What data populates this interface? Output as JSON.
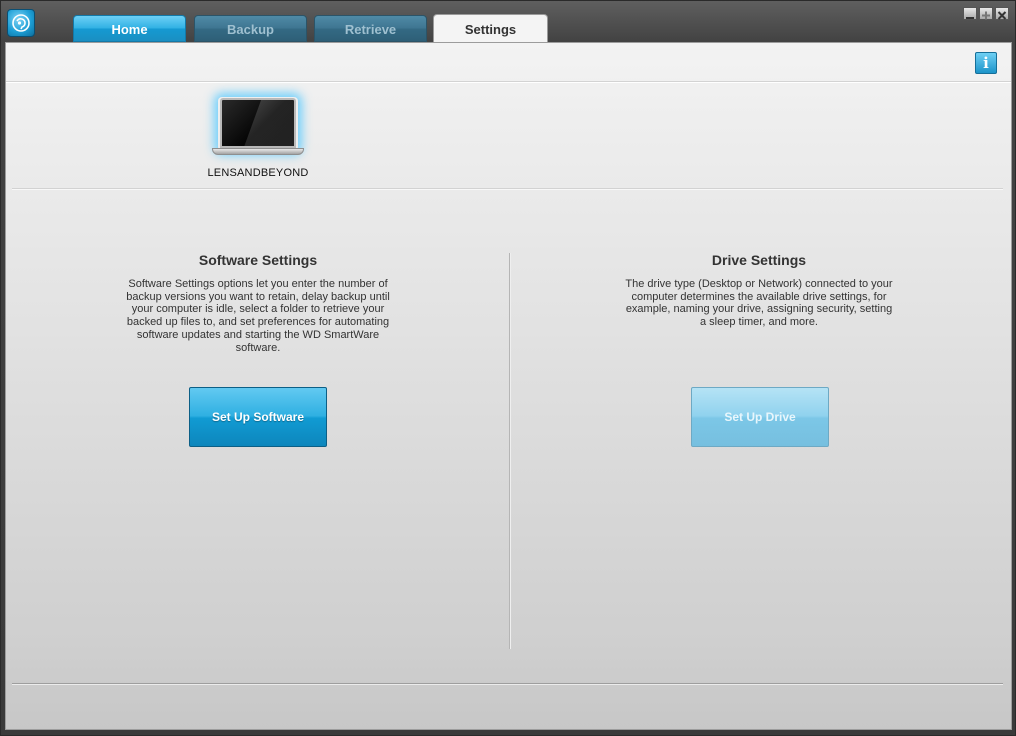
{
  "window": {
    "app_icon": "wd-smartware-app-icon",
    "controls": {
      "minimize_icon": "minimize-icon",
      "maximize_icon": "maximize-icon",
      "close_icon": "close-icon"
    }
  },
  "tabs": [
    {
      "label": "Home",
      "state": "enabled"
    },
    {
      "label": "Backup",
      "state": "disabled"
    },
    {
      "label": "Retrieve",
      "state": "disabled"
    },
    {
      "label": "Settings",
      "state": "active"
    }
  ],
  "toolbar": {
    "info_icon": "info-icon",
    "info_glyph": "i"
  },
  "device": {
    "icon": "laptop-icon",
    "name": "LENSANDBEYOND"
  },
  "software_settings": {
    "title": "Software Settings",
    "description": "Software Settings options let you enter the number of backup versions you want to retain, delay backup until your computer is idle, select a folder to retrieve your backed up files to, and set preferences for automating software updates and starting the WD SmartWare software.",
    "button_label": "Set Up Software",
    "button_state": "enabled"
  },
  "drive_settings": {
    "title": "Drive Settings",
    "description": "The drive type (Desktop or Network) connected to your computer determines the available drive settings, for example, naming your drive, assigning security, setting a sleep timer, and more.",
    "button_label": "Set Up Drive",
    "button_state": "disabled"
  },
  "colors": {
    "accent_blue": "#1c9fd6",
    "disabled_blue": "#8fd0ec",
    "chrome_dark": "#434343"
  }
}
